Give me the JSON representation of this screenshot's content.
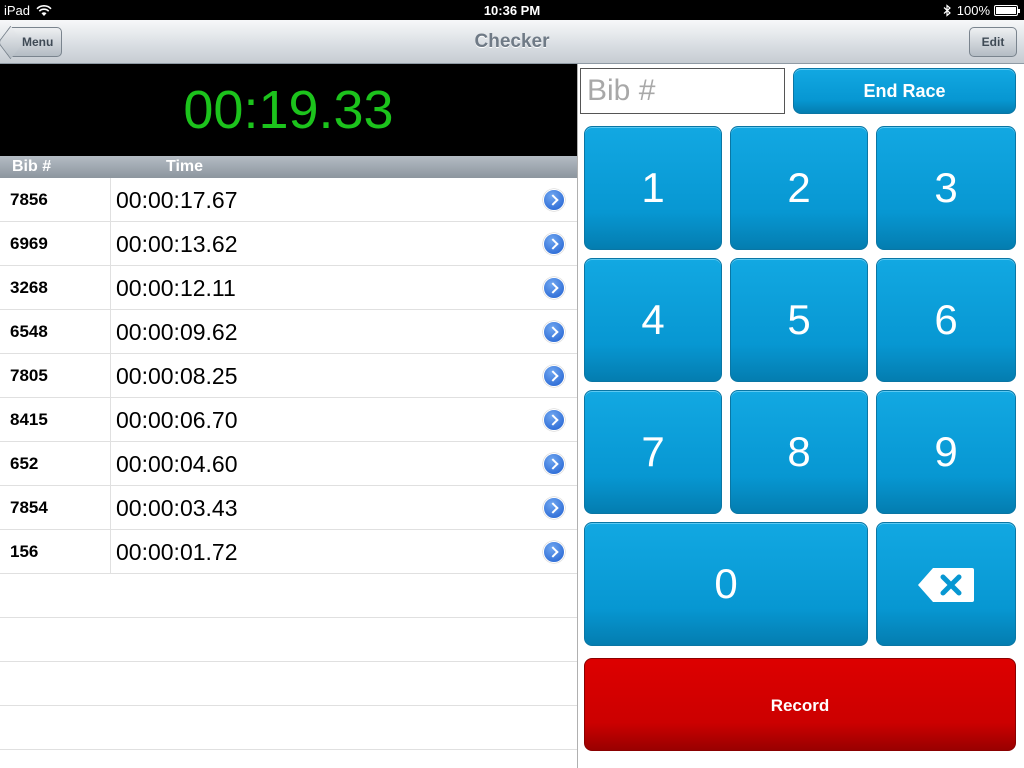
{
  "status_bar": {
    "device": "iPad",
    "time": "10:36 PM",
    "battery": "100%"
  },
  "nav": {
    "title": "Checker",
    "back_label": "Menu",
    "edit_label": "Edit"
  },
  "timer": {
    "display": "00:19.33",
    "color": "#1cc31c"
  },
  "table": {
    "columns": [
      "Bib #",
      "Time"
    ],
    "rows": [
      {
        "bib": "7856",
        "time": "00:00:17.67"
      },
      {
        "bib": "6969",
        "time": "00:00:13.62"
      },
      {
        "bib": "3268",
        "time": "00:00:12.11"
      },
      {
        "bib": "6548",
        "time": "00:00:09.62"
      },
      {
        "bib": "7805",
        "time": "00:00:08.25"
      },
      {
        "bib": "8415",
        "time": "00:00:06.70"
      },
      {
        "bib": "652",
        "time": "00:00:04.60"
      },
      {
        "bib": "7854",
        "time": "00:00:03.43"
      },
      {
        "bib": "156",
        "time": "00:00:01.72"
      }
    ]
  },
  "bib_input": {
    "placeholder": "Bib #",
    "value": ""
  },
  "end_race_label": "End Race",
  "keypad": {
    "keys": [
      "1",
      "2",
      "3",
      "4",
      "5",
      "6",
      "7",
      "8",
      "9",
      "0"
    ],
    "backspace_icon": "backspace-icon"
  },
  "record_label": "Record",
  "colors": {
    "accent_blue": "#0797d2",
    "record_red": "#cc0000"
  }
}
